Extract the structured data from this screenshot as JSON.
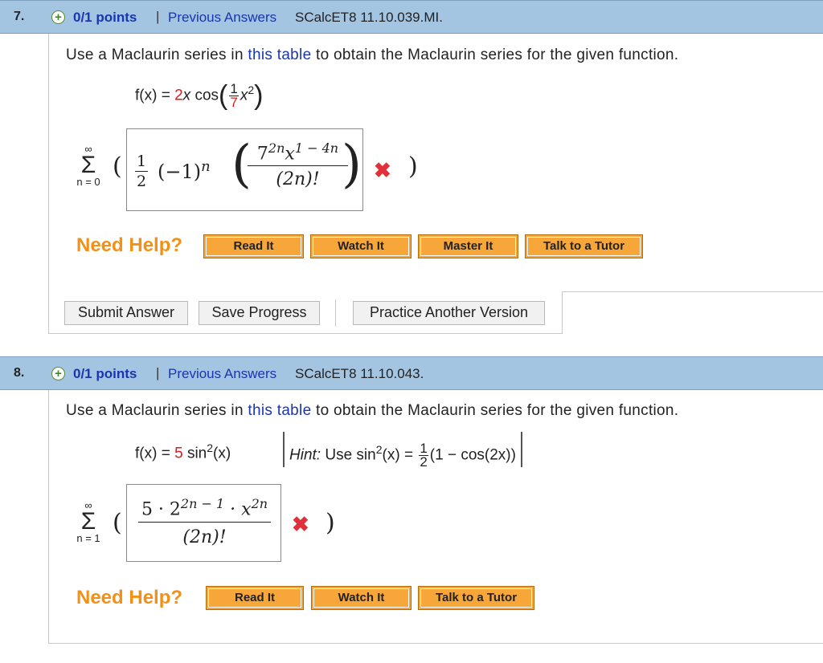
{
  "questions": [
    {
      "number": "7.",
      "points": "0/1 points",
      "separator": "|",
      "previous_answers": "Previous Answers",
      "code": "SCalcET8 11.10.039.MI.",
      "prompt_before": "Use a Maclaurin series in ",
      "prompt_link": "this table",
      "prompt_after": " to obtain the Maclaurin series for the given function.",
      "function": {
        "lhs": "f(x) = ",
        "coef": "2",
        "var": "x",
        "fn": " cos",
        "frac_num": "1",
        "frac_den": "7",
        "arg": "x",
        "exp": "2"
      },
      "sum": {
        "upper": "∞",
        "lower": "n = 0"
      },
      "answer": {
        "half_num": "1",
        "half_den": "2",
        "neg_one": "(−1)",
        "n_exp": "n",
        "num_base": "7",
        "num_exp": "2n",
        "num_var": "x",
        "num_exp2": "1 − 4n",
        "den": "(2n)!"
      },
      "wrong_mark": "✖",
      "need_help": "Need Help?",
      "help_buttons": [
        "Read It",
        "Watch It",
        "Master It",
        "Talk to a Tutor"
      ],
      "submit_buttons": [
        "Submit Answer",
        "Save Progress",
        "Practice Another Version"
      ]
    },
    {
      "number": "8.",
      "points": "0/1 points",
      "separator": "|",
      "previous_answers": "Previous Answers",
      "code": "SCalcET8 11.10.043.",
      "prompt_before": "Use a Maclaurin series in ",
      "prompt_link": "this table",
      "prompt_after": " to obtain the Maclaurin series for the given function.",
      "function": {
        "lhs": "f(x) = ",
        "coef": "5",
        "fn": " sin",
        "exp": "2",
        "arg": "(x)"
      },
      "hint": {
        "label": "Hint:",
        "text1": " Use sin",
        "exp": "2",
        "text2": "(x) = ",
        "frac_num": "1",
        "frac_den": "2",
        "text3": "(1 − cos(2x))"
      },
      "sum": {
        "upper": "∞",
        "lower": "n = 1"
      },
      "answer": {
        "num_coef": "5 · 2",
        "num_exp": "2n − 1",
        "num_dot": " · x",
        "num_exp2": "2n",
        "den": "(2n)!"
      },
      "wrong_mark": "✖",
      "need_help": "Need Help?",
      "help_buttons": [
        "Read It",
        "Watch It",
        "Talk to a Tutor"
      ]
    }
  ]
}
